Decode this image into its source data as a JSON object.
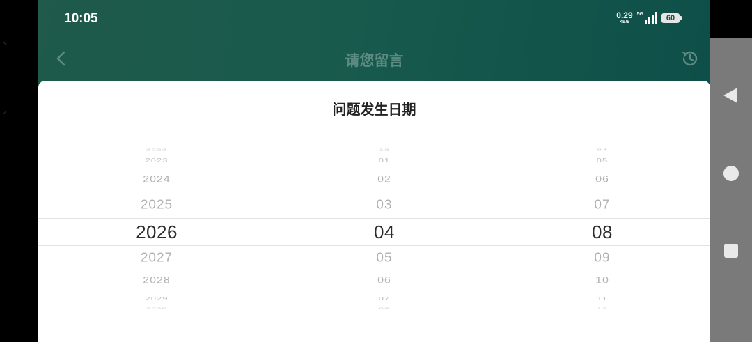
{
  "status_bar": {
    "time": "10:05",
    "net_speed_value": "0.29",
    "net_speed_unit": "KB/S",
    "network_type": "5G",
    "signal_icon": "signal-bars-icon",
    "battery_level": "60"
  },
  "header": {
    "title": "请您留言",
    "back_icon": "chevron-left-icon",
    "history_icon": "clock-history-icon"
  },
  "sheet": {
    "title": "问题发生日期"
  },
  "picker": {
    "years": [
      "2022",
      "2023",
      "2024",
      "2025",
      "2026",
      "2027",
      "2028",
      "2029",
      "2030"
    ],
    "months": [
      "12",
      "01",
      "02",
      "03",
      "04",
      "05",
      "06",
      "07",
      "08"
    ],
    "days": [
      "04",
      "05",
      "06",
      "07",
      "08",
      "09",
      "10",
      "11",
      "12"
    ],
    "selected": {
      "year": "2026",
      "month": "04",
      "day": "08"
    }
  },
  "system_nav": {
    "back_icon": "triangle-back-icon",
    "home_icon": "circle-home-icon",
    "recents_icon": "square-recents-icon"
  },
  "colors": {
    "header_bg": "#185a4c",
    "header_title": "#5c8b82",
    "nav_bar": "#7a7a7a"
  }
}
